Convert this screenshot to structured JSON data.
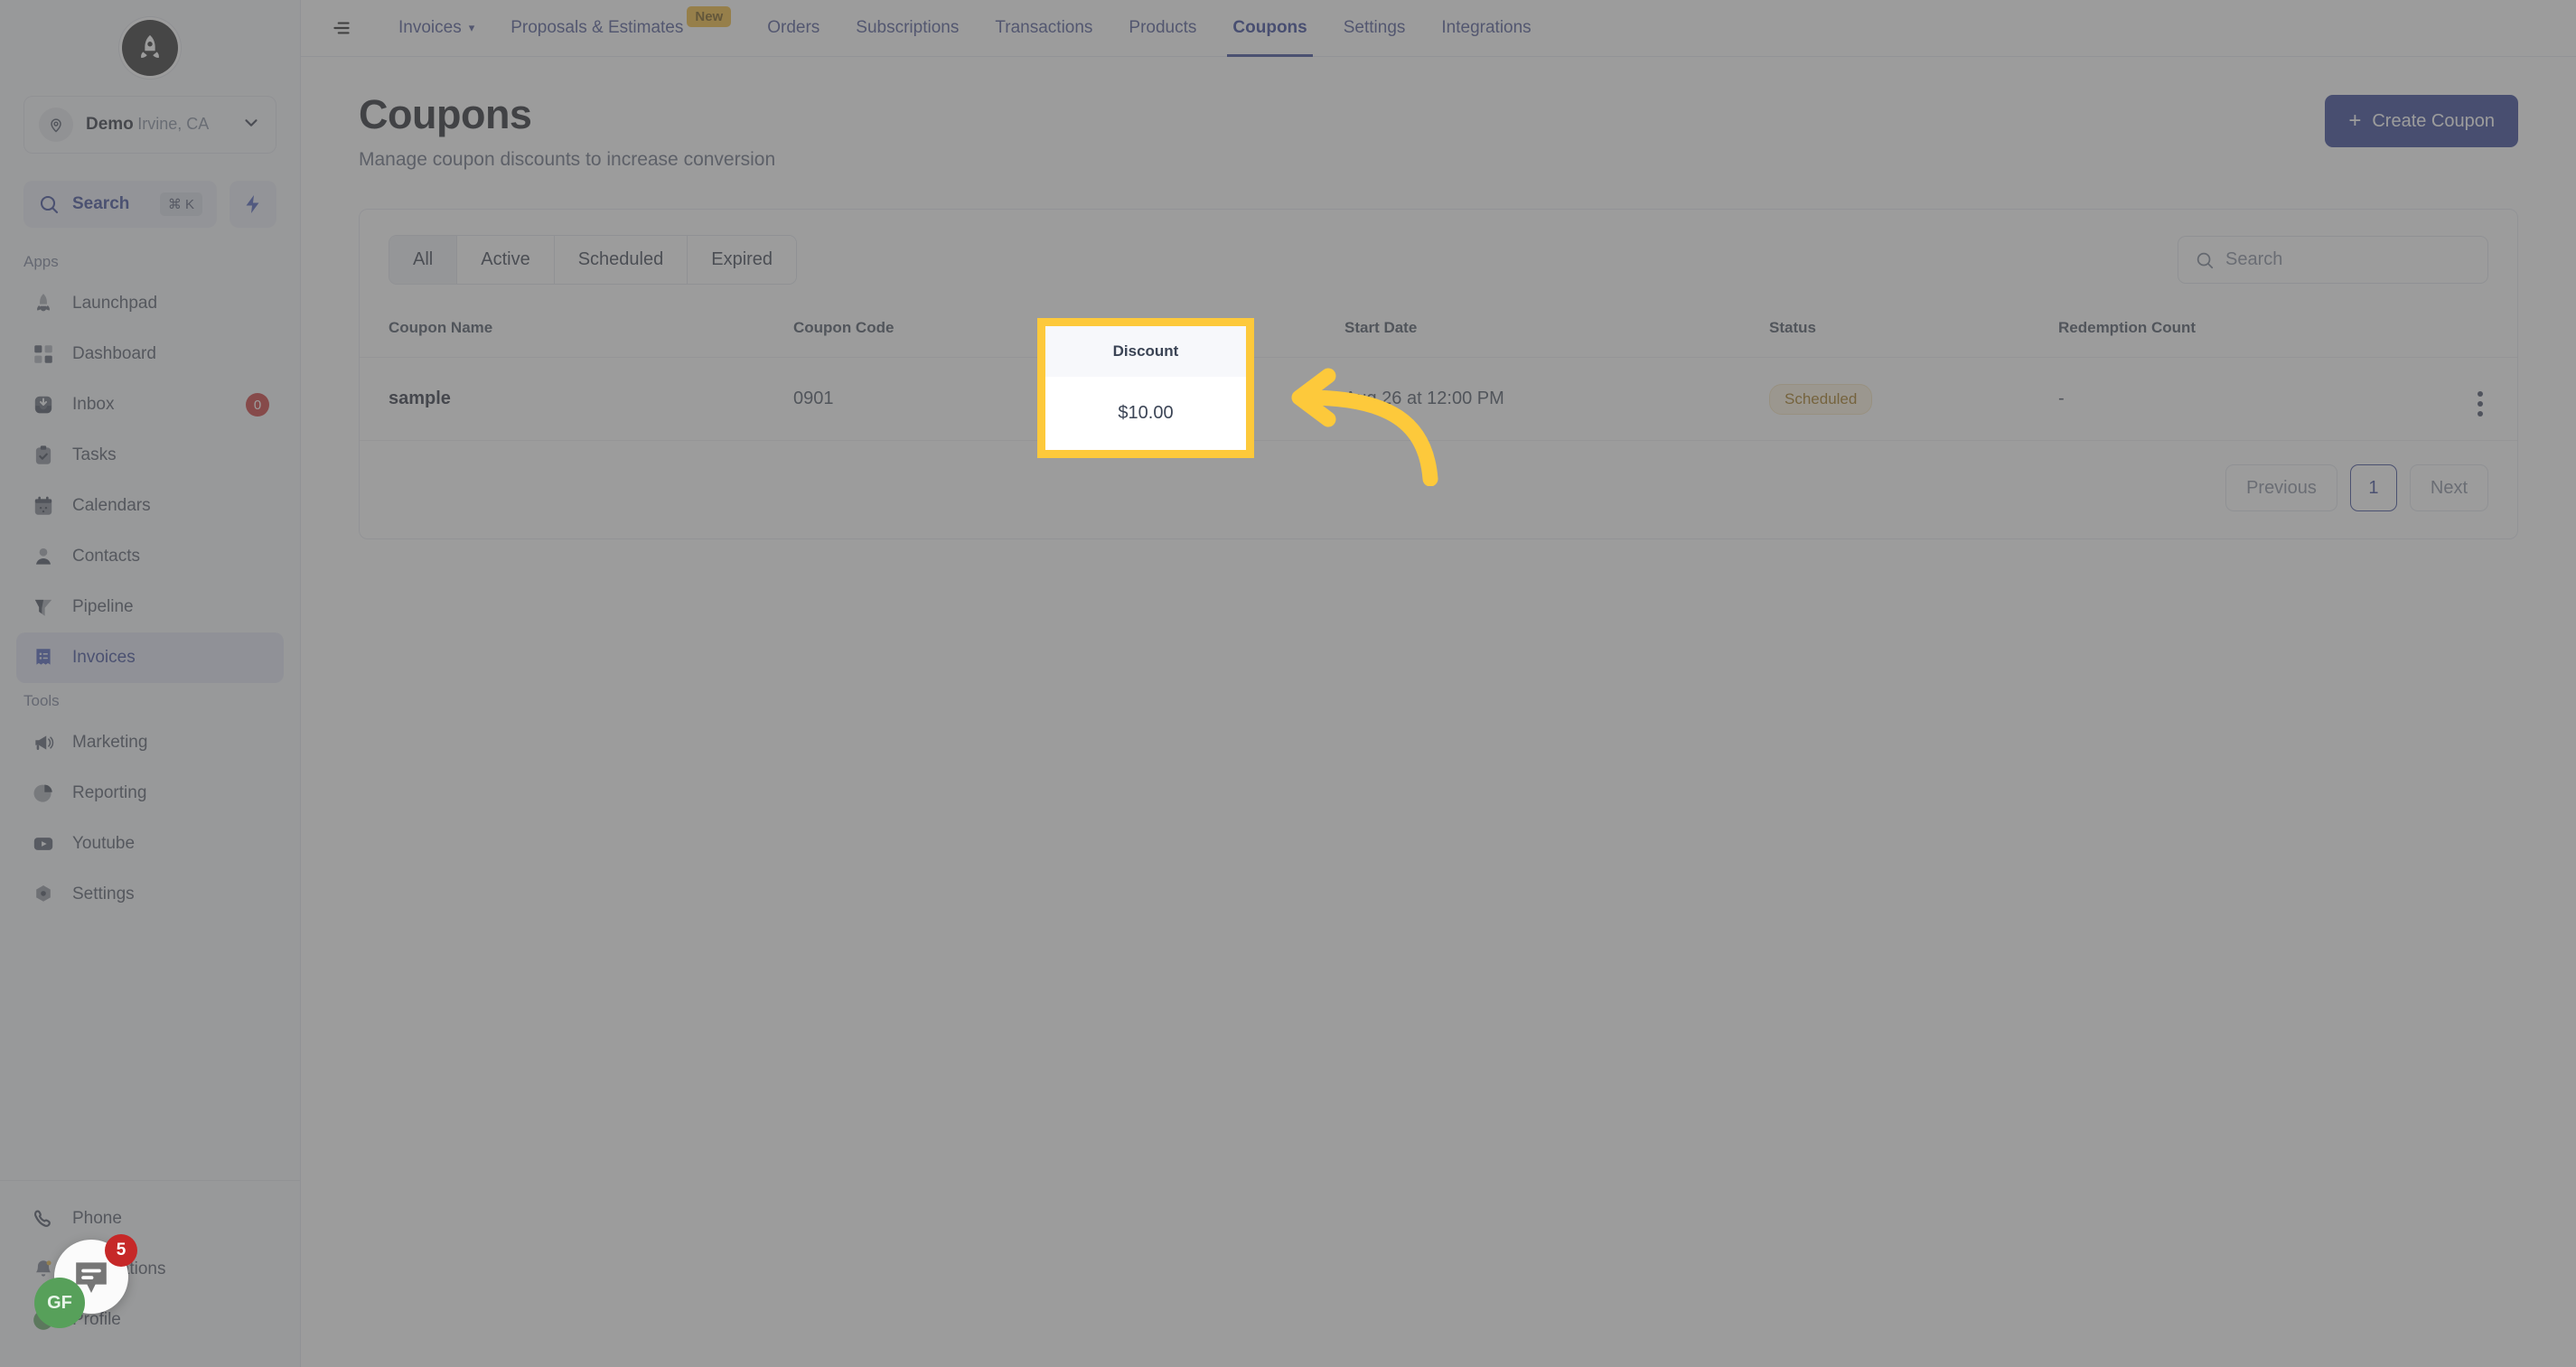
{
  "brand": {
    "logo_icon": "rocket-logo-icon",
    "accent_blue": "#2b3a8f",
    "highlight_yellow": "#fdc93b",
    "status_amber": "#9a6b08"
  },
  "sidebar": {
    "location": {
      "name": "Demo",
      "subtitle": "Irvine, CA",
      "pin_icon": "map-pin-icon",
      "chevron_icon": "chevron-down-icon"
    },
    "search": {
      "label": "Search",
      "shortcut": "⌘ K",
      "icon": "search-icon",
      "quick_action_icon": "lightning-bolt-icon"
    },
    "groups": [
      {
        "label": "Apps",
        "items": [
          {
            "label": "Launchpad",
            "icon": "rocket-icon",
            "badge": null,
            "active": false
          },
          {
            "label": "Dashboard",
            "icon": "grid-icon",
            "badge": null,
            "active": false
          },
          {
            "label": "Inbox",
            "icon": "inbox-icon",
            "badge": "0",
            "active": false
          },
          {
            "label": "Tasks",
            "icon": "clipboard-check-icon",
            "badge": null,
            "active": false
          },
          {
            "label": "Calendars",
            "icon": "calendar-icon",
            "badge": null,
            "active": false
          },
          {
            "label": "Contacts",
            "icon": "user-icon",
            "badge": null,
            "active": false
          },
          {
            "label": "Pipeline",
            "icon": "funnel-icon",
            "badge": null,
            "active": false
          },
          {
            "label": "Invoices",
            "icon": "invoice-icon",
            "badge": null,
            "active": true
          }
        ]
      },
      {
        "label": "Tools",
        "items": [
          {
            "label": "Marketing",
            "icon": "megaphone-icon",
            "badge": null,
            "active": false
          },
          {
            "label": "Reporting",
            "icon": "pie-chart-icon",
            "badge": null,
            "active": false
          },
          {
            "label": "Youtube",
            "icon": "youtube-icon",
            "badge": null,
            "active": false
          },
          {
            "label": "Settings",
            "icon": "gear-icon",
            "badge": null,
            "active": false
          }
        ]
      }
    ],
    "bottom_items": [
      {
        "label": "Phone",
        "icon": "phone-icon"
      },
      {
        "label": "Notifications",
        "icon": "bell-icon"
      },
      {
        "label": "Profile",
        "icon": "profile-avatar-icon"
      }
    ]
  },
  "topnav": {
    "menu_icon": "hamburger-menu-icon",
    "items": [
      {
        "label": "Invoices",
        "caret": true,
        "badge": null,
        "active": false
      },
      {
        "label": "Proposals & Estimates",
        "caret": false,
        "badge": "New",
        "active": false
      },
      {
        "label": "Orders",
        "caret": false,
        "badge": null,
        "active": false
      },
      {
        "label": "Subscriptions",
        "caret": false,
        "badge": null,
        "active": false
      },
      {
        "label": "Transactions",
        "caret": false,
        "badge": null,
        "active": false
      },
      {
        "label": "Products",
        "caret": false,
        "badge": null,
        "active": false
      },
      {
        "label": "Coupons",
        "caret": false,
        "badge": null,
        "active": true
      },
      {
        "label": "Settings",
        "caret": false,
        "badge": null,
        "active": false
      },
      {
        "label": "Integrations",
        "caret": false,
        "badge": null,
        "active": false
      }
    ]
  },
  "page": {
    "title": "Coupons",
    "subtitle": "Manage coupon discounts to increase conversion",
    "create_button": {
      "label": "Create Coupon",
      "plus": "+"
    }
  },
  "filters": {
    "tabs": [
      {
        "label": "All",
        "active": true
      },
      {
        "label": "Active",
        "active": false
      },
      {
        "label": "Scheduled",
        "active": false
      },
      {
        "label": "Expired",
        "active": false
      }
    ],
    "search_placeholder": "Search",
    "search_value": "",
    "search_icon": "search-icon"
  },
  "table": {
    "columns": [
      "Coupon Name",
      "Coupon Code",
      "Discount",
      "Start Date",
      "Status",
      "Redemption Count"
    ],
    "rows": [
      {
        "coupon_name": "sample",
        "coupon_code": "0901",
        "discount": "$10.00",
        "start_date": "Aug 26 at 12:00 PM",
        "status": "Scheduled",
        "redemption_count": "-",
        "actions_icon": "kebab-menu-icon"
      }
    ]
  },
  "pagination": {
    "previous": "Previous",
    "current_page": "1",
    "next": "Next"
  },
  "callout": {
    "header": "Discount",
    "value": "$10.00",
    "arrow_icon": "curved-arrow-left-icon"
  },
  "chat_widget": {
    "icon": "chat-bubble-icon",
    "unread": "5",
    "avatar_initials": "GF"
  }
}
